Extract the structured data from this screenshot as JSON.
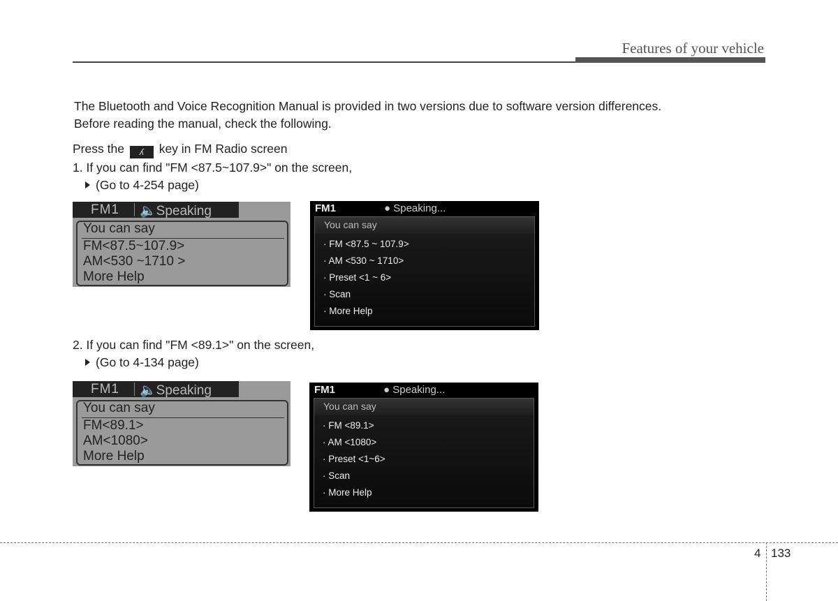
{
  "header": {
    "title": "Features of your vehicle"
  },
  "intro": {
    "line1": "The Bluetooth and Voice Recognition Manual is provided in two versions due to software version differences.",
    "line2": "Before reading the manual, check the following."
  },
  "instruction": {
    "before": "Press the",
    "key_icon": "voice-key-icon",
    "after": "key in FM Radio screen"
  },
  "cases": [
    {
      "condition": "1. If you can find \"FM <87.5~107.9>\" on the screen,",
      "goto": "(Go to 4-254 page)",
      "lcd": {
        "band": "FM1",
        "status": "Speaking",
        "header": "You can say",
        "items": [
          "FM<87.5~107.9>",
          "AM<530 ~1710 >",
          "More Help"
        ]
      },
      "dark": {
        "band": "FM1",
        "status": "Speaking...",
        "header": "You can say",
        "items": [
          "· FM <87.5 ~ 107.9>",
          "· AM <530 ~ 1710>",
          "· Preset <1 ~ 6>",
          "· Scan",
          "· More Help"
        ]
      }
    },
    {
      "condition": "2. If you can find \"FM <89.1>\" on the screen,",
      "goto": "(Go to 4-134 page)",
      "lcd": {
        "band": "FM1",
        "status": "Speaking",
        "header": "You can say",
        "items": [
          "FM<89.1>",
          "AM<1080>",
          "More Help"
        ]
      },
      "dark": {
        "band": "FM1",
        "status": "Speaking...",
        "header": "You can say",
        "items": [
          "· FM <89.1>",
          "· AM <1080>",
          "· Preset <1~6>",
          "· Scan",
          "· More Help"
        ]
      }
    }
  ],
  "footer": {
    "section": "4",
    "page": "133"
  }
}
